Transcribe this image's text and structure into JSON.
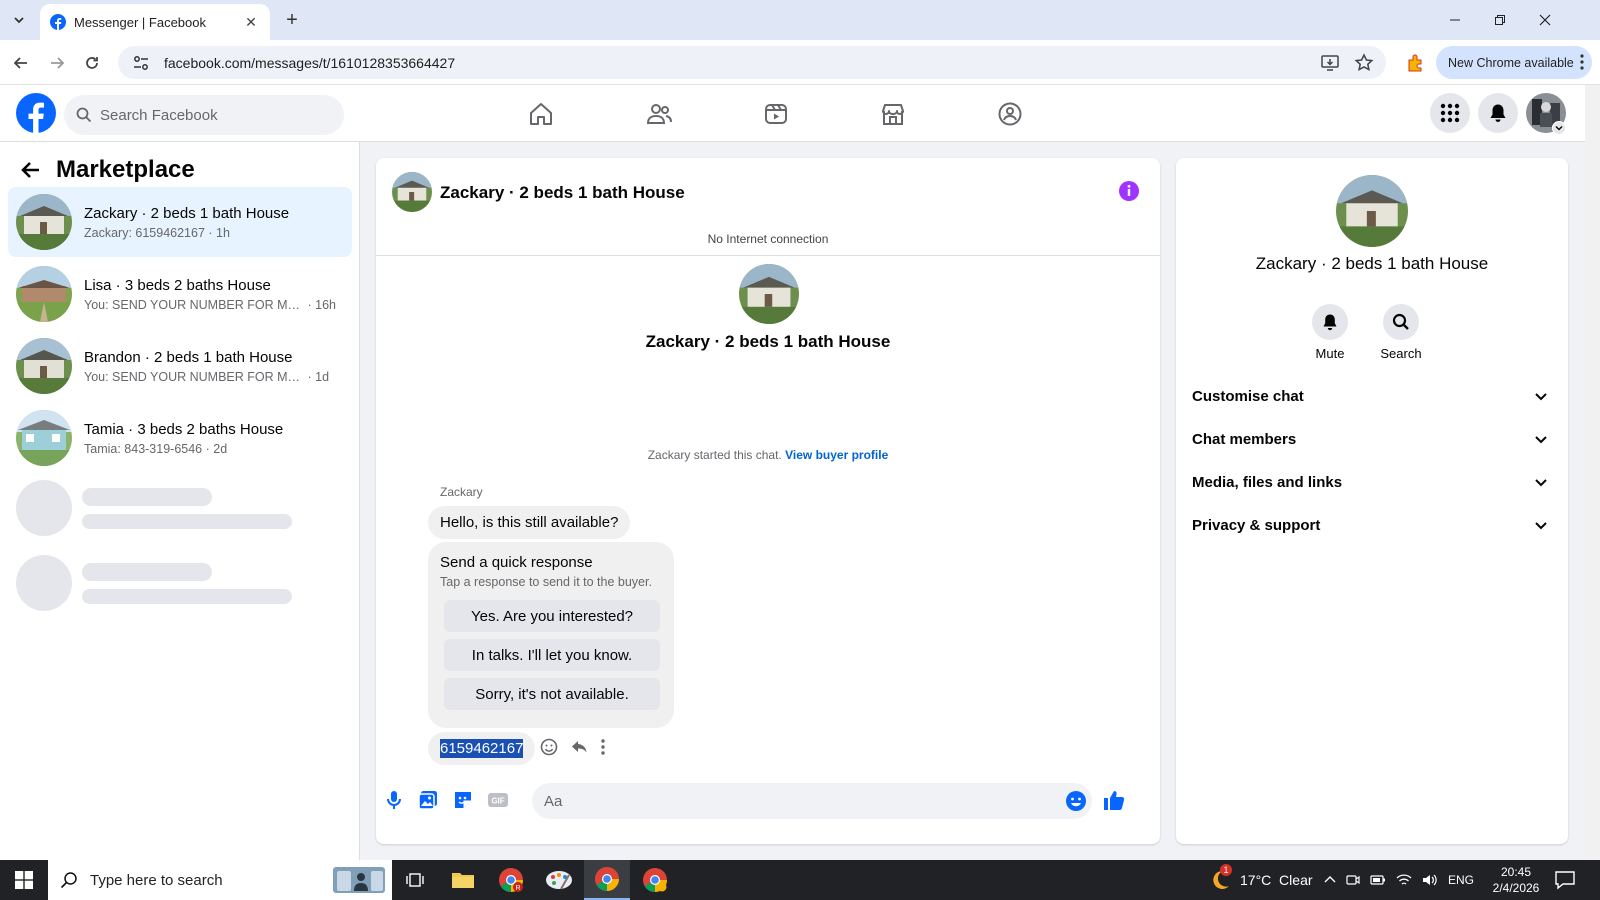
{
  "browser": {
    "tab_title": "Messenger | Facebook",
    "url": "facebook.com/messages/t/1610128353664427",
    "update_label": "New Chrome available"
  },
  "fb": {
    "search_placeholder": "Search Facebook"
  },
  "sidebar": {
    "title": "Marketplace",
    "conversations": [
      {
        "name": "Zackary · 2 beds 1 bath House",
        "preview": "Zackary: 6159462167",
        "time": "· 1h"
      },
      {
        "name": "Lisa · 3 beds 2 baths House",
        "preview": "You: SEND YOUR NUMBER FOR MO...",
        "time": "· 16h"
      },
      {
        "name": "Brandon · 2 beds 1 bath House",
        "preview": "You: SEND YOUR NUMBER FOR MOR...",
        "time": "· 1d"
      },
      {
        "name": "Tamia · 3 beds 2 baths House",
        "preview": "Tamia: 843-319-6546",
        "time": "· 2d"
      }
    ]
  },
  "chat": {
    "title": "Zackary · 2 beds 1 bath House",
    "status": "No Internet connection",
    "started_text": "Zackary started this chat.",
    "started_link": "View buyer profile",
    "sender": "Zackary",
    "messages": [
      "Hello, is this still available?",
      "6159462167"
    ],
    "quick_title": "Send a quick response",
    "quick_sub": "Tap a response to send it to the buyer.",
    "quick_options": [
      "Yes. Are you interested?",
      "In talks. I'll let you know.",
      "Sorry, it's not available."
    ],
    "input_placeholder": "Aa"
  },
  "info": {
    "title": "Zackary · 2 beds 1 bath House",
    "actions": [
      "Mute",
      "Search"
    ],
    "sections": [
      "Customise chat",
      "Chat members",
      "Media, files and links",
      "Privacy & support"
    ]
  },
  "taskbar": {
    "search_placeholder": "Type here to search",
    "weather": "17°C  Clear",
    "weather_badge": "1",
    "lang": "ENG",
    "time": "20:45",
    "date": "2/4/2026"
  },
  "colors": {
    "fb_blue": "#0866ff",
    "messenger_purple": "#a033ff",
    "active_row": "#e7f3ff"
  }
}
